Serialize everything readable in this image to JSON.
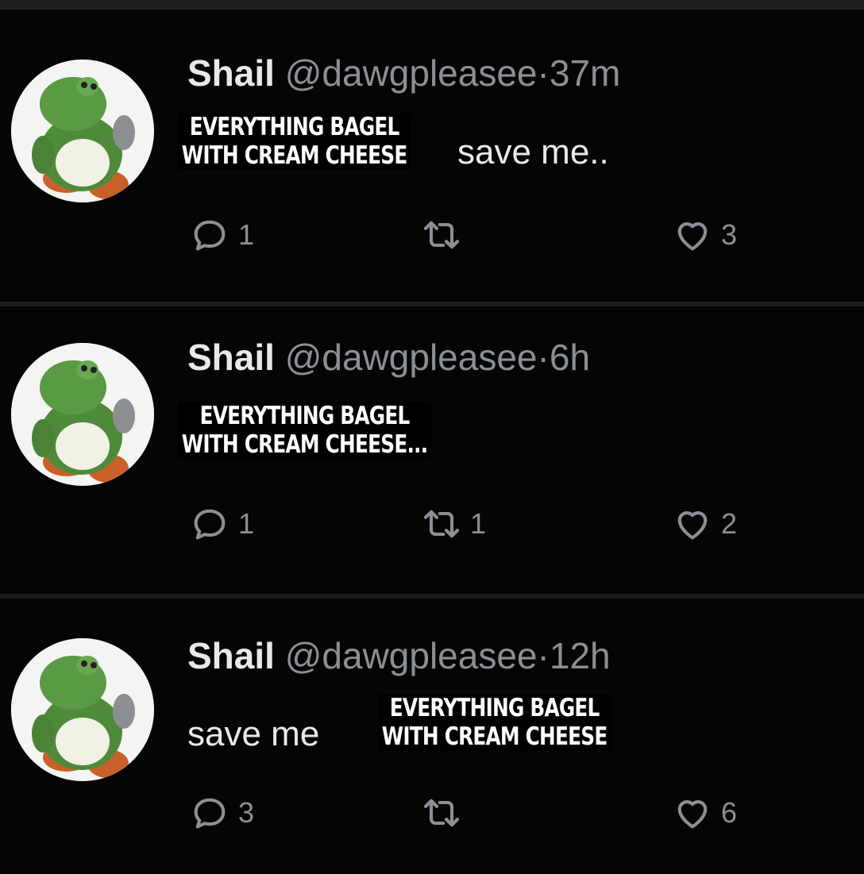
{
  "tweets": [
    {
      "display_name": "Shail",
      "handle": "@dawgpleasee",
      "separator": "·",
      "time": "37m",
      "body": "save me..",
      "overlay_lines": [
        "EVERYTHING BAGEL",
        "WITH CREAM CHEESE"
      ],
      "replies": "1",
      "retweets": "",
      "likes": "3"
    },
    {
      "display_name": "Shail",
      "handle": "@dawgpleasee",
      "separator": "·",
      "time": "6h",
      "body": "",
      "overlay_lines": [
        "EVERYTHING BAGEL",
        "WITH CREAM CHEESE..."
      ],
      "replies": "1",
      "retweets": "1",
      "likes": "2"
    },
    {
      "display_name": "Shail",
      "handle": "@dawgpleasee",
      "separator": "·",
      "time": "12h",
      "body": "save me",
      "overlay_lines": [
        "EVERYTHING BAGEL",
        "WITH CREAM CHEESE"
      ],
      "replies": "3",
      "retweets": "",
      "likes": "6"
    }
  ],
  "icons": {
    "avatar": "green-frog-character-avatar",
    "reply": "reply-bubble-icon",
    "retweet": "retweet-arrows-icon",
    "like": "heart-icon"
  },
  "colors": {
    "background": "#000000",
    "text_primary": "#e7e9ea",
    "text_secondary": "#8b9096"
  }
}
